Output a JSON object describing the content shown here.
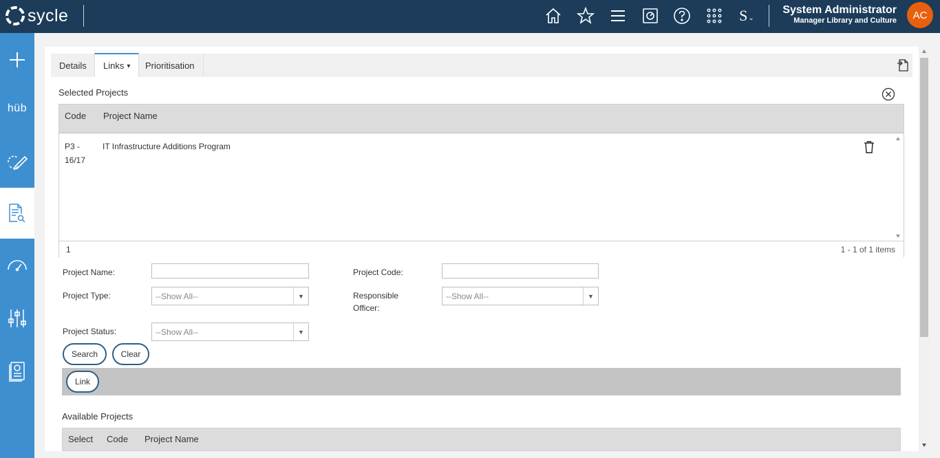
{
  "header": {
    "logo_text": "sycle",
    "user_name": "System Administrator",
    "user_role": "Manager Library and Culture",
    "avatar_initials": "AC",
    "icons": [
      "home-icon",
      "star-icon",
      "menu-icon",
      "dashboard-icon",
      "help-icon",
      "apps-grid-icon",
      "s-dropdown-icon"
    ],
    "s_dropdown_label": "S"
  },
  "sidebar": {
    "items": [
      {
        "icon": "plus-icon"
      },
      {
        "icon": "hub-icon",
        "label": "hüb"
      },
      {
        "icon": "cycle-pencil-icon"
      },
      {
        "icon": "document-search-icon",
        "active": true
      },
      {
        "icon": "gauge-icon"
      },
      {
        "icon": "sliders-icon"
      },
      {
        "icon": "report-icon"
      }
    ]
  },
  "tabs": [
    {
      "label": "Details"
    },
    {
      "label": "Links",
      "active": true,
      "caret": "▾"
    },
    {
      "label": "Prioritisation"
    }
  ],
  "selected_projects": {
    "title": "Selected Projects",
    "columns": [
      "Code",
      "Project Name"
    ],
    "rows": [
      {
        "code": "P3 - 16/17",
        "name": "IT Infrastructure Additions Program"
      }
    ],
    "pager": {
      "page": "1",
      "info": "1 - 1 of 1 items"
    }
  },
  "filters": {
    "project_name_label": "Project Name:",
    "project_name_value": "",
    "project_code_label": "Project Code:",
    "project_code_value": "",
    "project_type_label": "Project Type:",
    "project_type_value": "--Show All--",
    "responsible_officer_label": "Responsible Officer:",
    "responsible_officer_value": "--Show All--",
    "project_status_label": "Project Status:",
    "project_status_value": "--Show All--"
  },
  "buttons": {
    "search": "Search",
    "clear": "Clear",
    "link": "Link"
  },
  "available_projects": {
    "title": "Available Projects",
    "columns": [
      "Select",
      "Code",
      "Project Name"
    ]
  },
  "colors": {
    "topbar": "#1c3c5a",
    "sidebar": "#3e8fd0",
    "avatar": "#e8600f",
    "button_border": "#2f5f86"
  }
}
